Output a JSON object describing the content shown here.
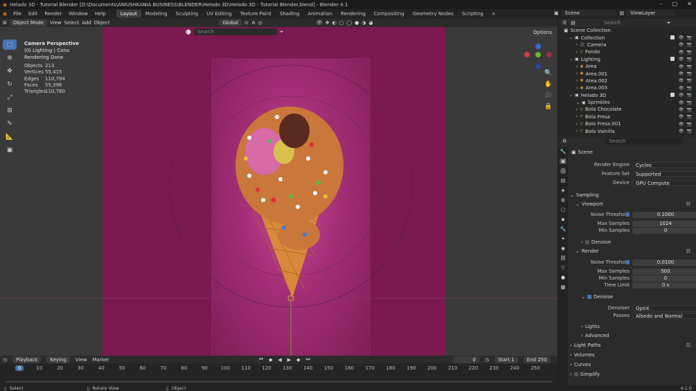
{
  "window": {
    "title": "Helado 3D - Tutorial Blender [D:\\Documents\\ANIUSHKANIA BUSINESS\\BLENDER\\Helado 3D\\Helado 3D - Tutorial Blender.blend] - Blender 4.1"
  },
  "menu": [
    "File",
    "Edit",
    "Render",
    "Window",
    "Help"
  ],
  "workspaces": [
    "Layout",
    "Modeling",
    "Sculpting",
    "UV Editing",
    "Texture Paint",
    "Shading",
    "Animation",
    "Rendering",
    "Compositing",
    "Geometry Nodes",
    "Scripting"
  ],
  "active_workspace": "Layout",
  "scene_name": "Scene",
  "view_layer": "ViewLayer",
  "viewport_header": {
    "mode": "Object Mode",
    "view": "View",
    "select": "Select",
    "add": "Add",
    "object": "Object",
    "orientation": "Global",
    "options": "Options"
  },
  "search_placeholder": "Search",
  "overlay": {
    "line1": "Camera Perspective",
    "line2": "(0) Lighting | Cono",
    "line3": "Rendering Done"
  },
  "stats": [
    {
      "k": "Objects",
      "v": "213"
    },
    {
      "k": "Vertices",
      "v": "55,415"
    },
    {
      "k": "Edges",
      "v": "110,794"
    },
    {
      "k": "Faces",
      "v": "55,396"
    },
    {
      "k": "Triangles",
      "v": "110,780"
    }
  ],
  "timeline": {
    "playback": "Playback",
    "keying": "Keying",
    "view": "View",
    "marker": "Marker",
    "current_frame": "0",
    "start_label": "Start",
    "start": "1",
    "end_label": "End",
    "end": "250",
    "ticks": [
      "0",
      "10",
      "20",
      "30",
      "40",
      "50",
      "60",
      "70",
      "80",
      "90",
      "100",
      "110",
      "120",
      "130",
      "140",
      "150",
      "160",
      "170",
      "180",
      "190",
      "200",
      "210",
      "220",
      "230",
      "240",
      "250"
    ]
  },
  "status": {
    "select": "Select",
    "rotate": "Rotate View",
    "object": "Object",
    "version": "4.1.0"
  },
  "outliner": {
    "title": "Scene Collection",
    "rows": [
      {
        "label": "Collection",
        "indent": 1,
        "type": "collection"
      },
      {
        "label": "Camera",
        "indent": 2,
        "type": "camera"
      },
      {
        "label": "Fondo",
        "indent": 2,
        "type": "mesh"
      },
      {
        "label": "Lighting",
        "indent": 1,
        "type": "collection"
      },
      {
        "label": "Area",
        "indent": 2,
        "type": "light"
      },
      {
        "label": "Area.001",
        "indent": 2,
        "type": "light"
      },
      {
        "label": "Area.002",
        "indent": 2,
        "type": "light"
      },
      {
        "label": "Area.003",
        "indent": 2,
        "type": "light"
      },
      {
        "label": "Helado 3D",
        "indent": 1,
        "type": "collection"
      },
      {
        "label": "Sprinkles",
        "indent": 2,
        "type": "collection"
      },
      {
        "label": "Bola Chocolate",
        "indent": 2,
        "type": "mesh"
      },
      {
        "label": "Bola Fresa",
        "indent": 2,
        "type": "mesh"
      },
      {
        "label": "Bola Fresa.001",
        "indent": 2,
        "type": "mesh"
      },
      {
        "label": "Bola Vainilla",
        "indent": 2,
        "type": "mesh"
      }
    ]
  },
  "properties": {
    "scene_label": "Scene",
    "render_engine_label": "Render Engine",
    "render_engine": "Cycles",
    "feature_set_label": "Feature Set",
    "feature_set": "Supported",
    "device_label": "Device",
    "device": "GPU Compute",
    "sampling": "Sampling",
    "viewport": "Viewport",
    "noise_threshold_label": "Noise Threshold",
    "vp_noise": "0.1000",
    "max_samples_label": "Max Samples",
    "vp_max": "1024",
    "min_samples_label": "Min Samples",
    "vp_min": "0",
    "denoise": "Denoise",
    "render": "Render",
    "r_noise": "0.0100",
    "r_max": "500",
    "r_min": "0",
    "time_limit_label": "Time Limit",
    "time_limit": "0 s",
    "denoiser_label": "Denoiser",
    "denoiser": "OptiX",
    "passes_label": "Passes",
    "passes": "Albedo and Normal",
    "lights": "Lights",
    "advanced": "Advanced",
    "light_paths": "Light Paths",
    "volumes": "Volumes",
    "curves": "Curves",
    "simplify": "Simplify"
  },
  "colors": {
    "accent": "#4772b3",
    "background_magenta": "#7a1a50"
  }
}
